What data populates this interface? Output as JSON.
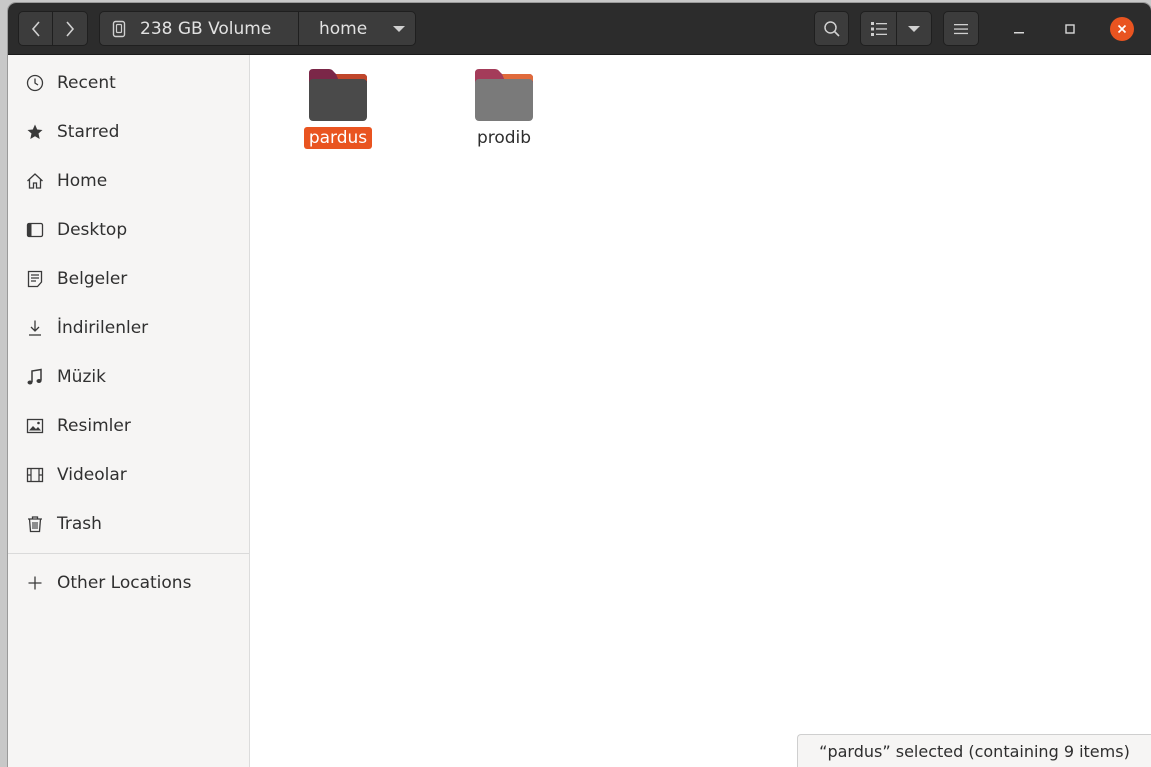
{
  "header": {
    "path": [
      {
        "label": "238 GB Volume",
        "icon": "drive-icon"
      },
      {
        "label": "home",
        "icon": "chevron-down-icon"
      }
    ],
    "icons": {
      "back": "chevron-left-icon",
      "forward": "chevron-right-icon",
      "search": "search-icon",
      "view": "list-view-icon",
      "view_menu": "chevron-down-icon",
      "menu": "hamburger-menu-icon",
      "minimize": "minimize-icon",
      "maximize": "maximize-icon",
      "close": "close-icon"
    }
  },
  "sidebar": {
    "items": [
      {
        "label": "Recent",
        "icon": "clock-icon"
      },
      {
        "label": "Starred",
        "icon": "star-icon"
      },
      {
        "label": "Home",
        "icon": "home-icon"
      },
      {
        "label": "Desktop",
        "icon": "desktop-icon"
      },
      {
        "label": "Belgeler",
        "icon": "document-icon"
      },
      {
        "label": "İndirilenler",
        "icon": "download-icon"
      },
      {
        "label": "Müzik",
        "icon": "music-icon"
      },
      {
        "label": "Resimler",
        "icon": "image-icon"
      },
      {
        "label": "Videolar",
        "icon": "video-icon"
      },
      {
        "label": "Trash",
        "icon": "trash-icon"
      }
    ],
    "other": {
      "label": "Other Locations",
      "icon": "plus-icon"
    }
  },
  "content": {
    "folders": [
      {
        "name": "pardus",
        "selected": true
      },
      {
        "name": "prodib",
        "selected": false
      }
    ]
  },
  "status": {
    "text": "“pardus” selected  (containing 9 items)"
  },
  "colors": {
    "accent": "#e95420",
    "headerbar": "#2c2c2c",
    "folder_tab": "#7b2748",
    "folder_tab_light": "#a43c5a"
  }
}
